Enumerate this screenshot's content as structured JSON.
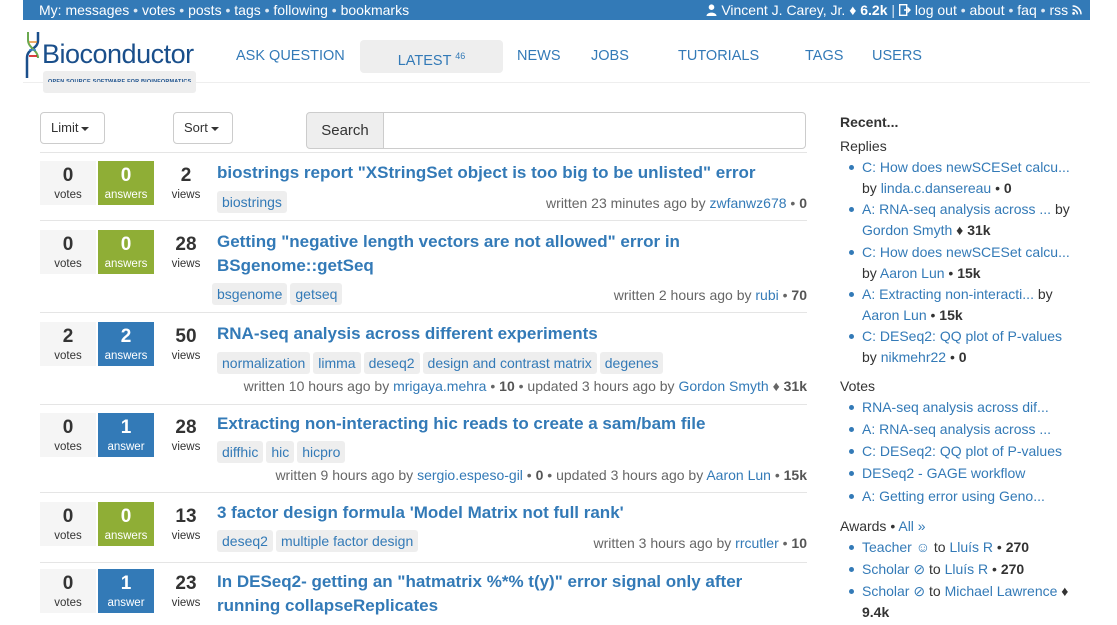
{
  "topbar": {
    "my_label": "My:",
    "links": [
      "messages",
      "votes",
      "posts",
      "tags",
      "following",
      "bookmarks"
    ],
    "user_name": "Vincent J. Carey, Jr.",
    "user_rep": "6.2k",
    "logout": "log out",
    "about": "about",
    "faq": "faq",
    "rss": "rss"
  },
  "logo": {
    "word": "Bioconductor",
    "tagline": "OPEN SOURCE SOFTWARE FOR BIOINFORMATICS"
  },
  "nav": {
    "ask": "ASK QUESTION",
    "latest": "LATEST",
    "latest_count": "46",
    "news": "NEWS",
    "jobs": "JOBS",
    "tutorials": "TUTORIALS",
    "tags": "TAGS",
    "users": "USERS"
  },
  "controls": {
    "limit": "Limit",
    "sort": "Sort",
    "search": "Search"
  },
  "posts": [
    {
      "votes": "0",
      "votes_label": "votes",
      "answers": "0",
      "answers_label": "answers",
      "views": "2",
      "views_label": "views",
      "title": "biostrings report \"XStringSet object is too big to be unlisted\" error",
      "tags": [
        "biostrings"
      ],
      "written": "written 23 minutes ago by",
      "author": "zwfanwz678",
      "author_rep": "0"
    },
    {
      "votes": "0",
      "votes_label": "votes",
      "answers": "0",
      "answers_label": "answers",
      "views": "28",
      "views_label": "views",
      "title": "Getting \"negative length vectors are not allowed\" error in BSgenome::getSeq",
      "tags": [
        "bsgenome",
        "getseq"
      ],
      "written": "written 2 hours ago by",
      "author": "rubi",
      "author_rep": "70"
    },
    {
      "votes": "2",
      "votes_label": "votes",
      "answers": "2",
      "answers_label": "answers",
      "views": "50",
      "views_label": "views",
      "title": "RNA-seq analysis across different experiments",
      "tags": [
        "normalization",
        "limma",
        "deseq2",
        "design and contrast matrix",
        "degenes"
      ],
      "written": "written 10 hours ago by",
      "author": "mrigaya.mehra",
      "author_rep": "10",
      "updated": "updated 3 hours ago by",
      "updater": "Gordon Smyth",
      "updater_rep": "31k"
    },
    {
      "votes": "0",
      "votes_label": "votes",
      "answers": "1",
      "answers_label": "answer",
      "views": "28",
      "views_label": "views",
      "title": "Extracting non-interacting hic reads to create a sam/bam file",
      "tags": [
        "diffhic",
        "hic",
        "hicpro"
      ],
      "written": "written 9 hours ago by",
      "author": "sergio.espeso-gil",
      "author_rep": "0",
      "updated": "updated 3 hours ago by",
      "updater": "Aaron Lun",
      "updater_rep": "15k"
    },
    {
      "votes": "0",
      "votes_label": "votes",
      "answers": "0",
      "answers_label": "answers",
      "views": "13",
      "views_label": "views",
      "title": "3 factor design formula 'Model Matrix not full rank'",
      "tags": [
        "deseq2",
        "multiple factor design"
      ],
      "written": "written 3 hours ago by",
      "author": "rrcutler",
      "author_rep": "10"
    },
    {
      "votes": "0",
      "votes_label": "votes",
      "answers": "1",
      "answers_label": "answer",
      "views": "23",
      "views_label": "views",
      "title": "In DESeq2- getting an \"hatmatrix %*% t(y)\" error signal only after running collapseReplicates"
    }
  ],
  "sidebar": {
    "heading": "Recent...",
    "replies_label": "Replies",
    "replies": [
      {
        "link": "C: How does newSCESet calcu...",
        "by": "by",
        "user": "linda.c.dansereau",
        "rep": "0"
      },
      {
        "link": "A: RNA-seq analysis across ...",
        "by": "by",
        "user": "Gordon Smyth",
        "rep": "31k"
      },
      {
        "link": "C: How does newSCESet calcu...",
        "by": "by",
        "user": "Aaron Lun",
        "rep": "15k"
      },
      {
        "link": "A: Extracting non-interacti...",
        "by": "by",
        "user": "Aaron Lun",
        "rep": "15k"
      },
      {
        "link": "C: DESeq2: QQ plot of P-values",
        "by": "by",
        "user": "nikmehr22",
        "rep": "0"
      }
    ],
    "votes_label": "Votes",
    "votes": [
      "RNA-seq analysis across dif...",
      "A: RNA-seq analysis across ...",
      "C: DESeq2: QQ plot of P-values",
      "DESeq2 - GAGE workflow",
      "A: Getting error using Geno..."
    ],
    "awards_label": "Awards",
    "awards_all": "All »",
    "awards": [
      {
        "badge": "Teacher",
        "to": "to",
        "user": "Lluís R",
        "rep": "270"
      },
      {
        "badge": "Scholar",
        "to": "to",
        "user": "Lluís R",
        "rep": "270"
      },
      {
        "badge": "Scholar",
        "to": "to",
        "user": "Michael Lawrence",
        "rep": "9.4k"
      }
    ]
  }
}
